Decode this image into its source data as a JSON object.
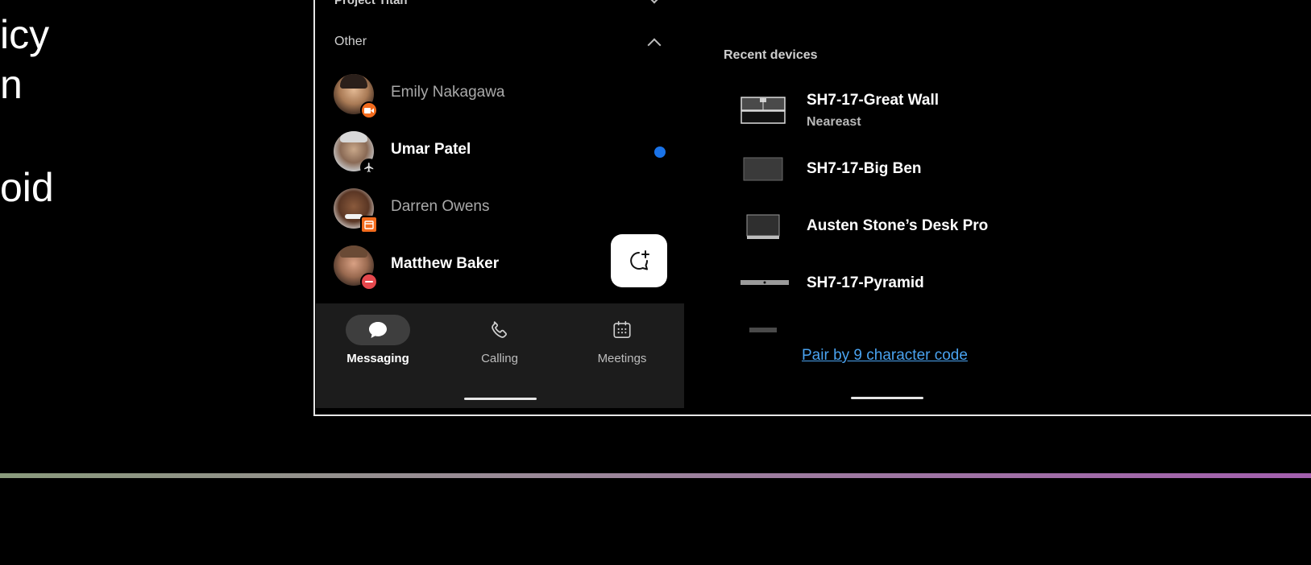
{
  "left_text": {
    "line1": "icy",
    "line2": "n",
    "line3": "oid"
  },
  "messaging": {
    "prev_section": "Project Titan",
    "section_label": "Other",
    "contacts": [
      {
        "name": "Emily Nakagawa",
        "bold": false,
        "status": "video-icon",
        "unread": false
      },
      {
        "name": "Umar Patel",
        "bold": true,
        "status": "airplane-icon",
        "unread": true
      },
      {
        "name": "Darren Owens",
        "bold": false,
        "status": "calendar-icon",
        "unread": false
      },
      {
        "name": "Matthew Baker",
        "bold": true,
        "status": "do-not-disturb-icon",
        "unread": false
      }
    ],
    "tabs": [
      {
        "label": "Messaging",
        "active": true
      },
      {
        "label": "Calling",
        "active": false
      },
      {
        "label": "Meetings",
        "active": false
      }
    ]
  },
  "devices": {
    "title": "Recent devices",
    "items": [
      {
        "name": "SH7-17-Great Wall",
        "sub": "Neareast"
      },
      {
        "name": "SH7-17-Big Ben",
        "sub": ""
      },
      {
        "name": "Austen Stone’s Desk Pro",
        "sub": ""
      },
      {
        "name": "SH7-17-Pyramid",
        "sub": ""
      }
    ],
    "pair_link": "Pair by 9 character code"
  },
  "colors": {
    "accent_blue": "#1a73e8",
    "link_blue": "#4aa3f0",
    "tabbar_bg": "#1c1c1c",
    "dnd_red": "#e5484d",
    "status_orange": "#f26b1d"
  }
}
